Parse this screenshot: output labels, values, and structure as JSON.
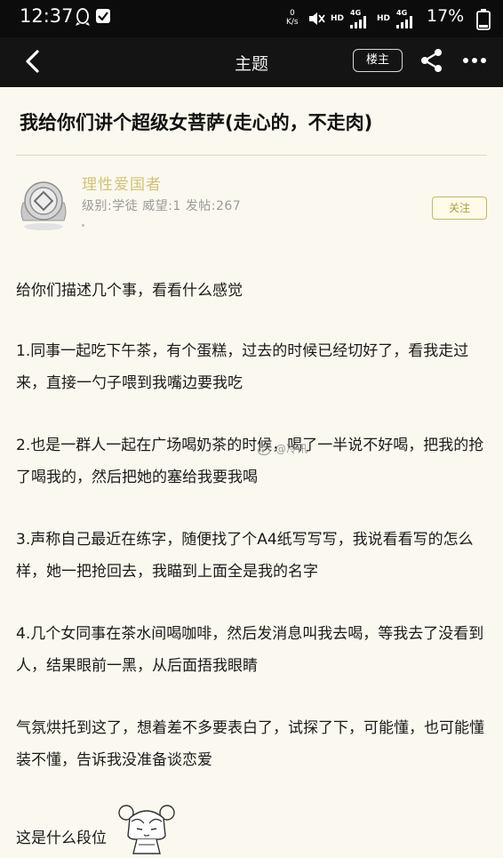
{
  "status_bar": {
    "time": "12:37",
    "net_speed_value": "0",
    "net_speed_unit": "K/s",
    "hd1": "HD",
    "g4_1": "4G",
    "hd2": "HD",
    "g4_2": "4G",
    "battery": "17%",
    "icons": [
      "qq-icon",
      "check-icon",
      "mute-icon",
      "signal-icon",
      "signal-icon",
      "battery-icon"
    ]
  },
  "nav": {
    "title": "主题",
    "op_label": "楼主",
    "icons": [
      "back-icon",
      "share-icon",
      "more-icon"
    ]
  },
  "post": {
    "title": "我给你们讲个超级女菩萨(走心的，不走肉)",
    "author": {
      "name": "理性爱国者",
      "meta": "级别:学徒 威望:1 发帖:267",
      "follow_label": "关注"
    },
    "paragraphs": [
      "给你们描述几个事，看看什么感觉",
      "1.同事一起吃下午茶，有个蛋糕，过去的时候已经切好了，看我走过来，直接一勺子喂到我嘴边要我吃",
      "2.也是一群人一起在广场喝奶茶的时候，喝了一半说不好喝，把我的抢了喝我的，然后把她的塞给我要我喝",
      "3.声称自己最近在练字，随便找了个A4纸写写写，我说看看写的怎么样，她一把抢回去，我瞄到上面全是我的名字",
      "4.几个女同事在茶水间喝咖啡，然后发消息叫我去喝，等我去了没看到人，结果眼前一黑，从后面捂我眼睛",
      "气氛烘托到这了，想着差不多要表白了，试探了下，可能懂，也可能懂装不懂，告诉我没准备谈恋爱",
      "这是什么段位"
    ],
    "watermark": "@冷讯"
  },
  "colors": {
    "background": "#fbf9ef",
    "bar": "#141414",
    "username": "#d2c27a",
    "follow_border": "#c9b56a"
  }
}
